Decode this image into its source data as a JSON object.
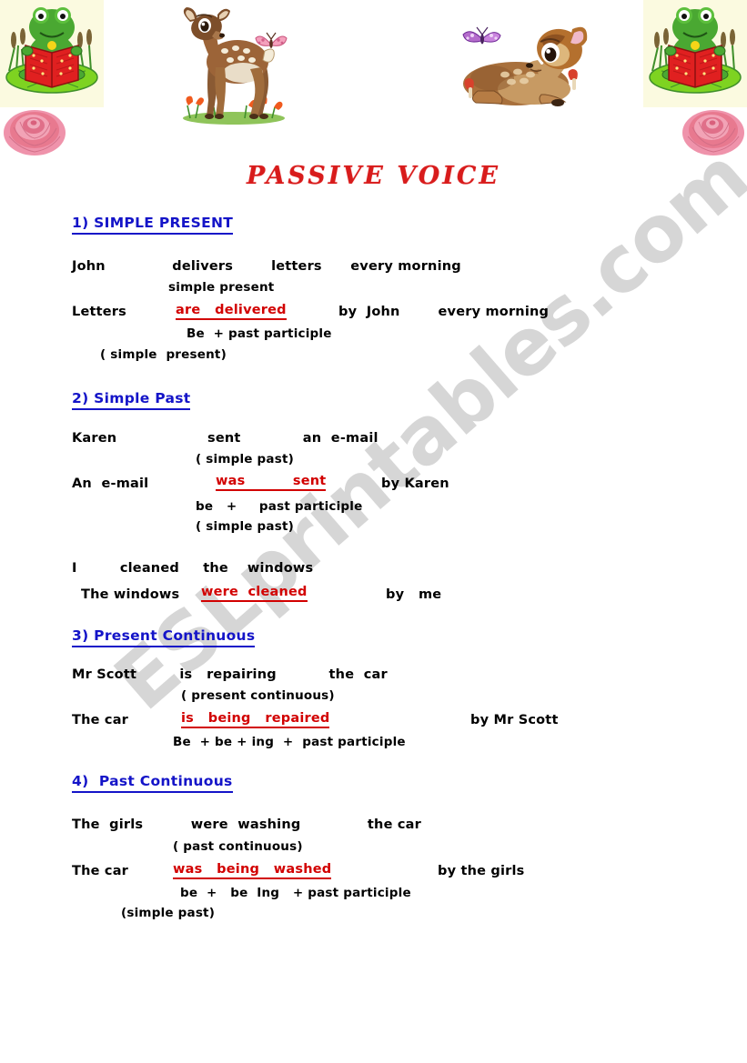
{
  "document": {
    "title": "PASSIVE VOICE",
    "watermark": "ESLprintables.com"
  },
  "clipart": [
    {
      "name": "frog-reading-book-left",
      "alt": "Green frog reading a red book on a lily pad"
    },
    {
      "name": "pink-rose-left",
      "alt": "Pink rose flower"
    },
    {
      "name": "standing-deer-with-butterfly",
      "alt": "Bambi deer standing with a pink butterfly"
    },
    {
      "name": "lying-deer-with-butterfly",
      "alt": "Bambi deer lying down with a purple butterfly"
    },
    {
      "name": "frog-reading-book-right",
      "alt": "Green frog reading a red book on a lily pad"
    },
    {
      "name": "pink-rose-right",
      "alt": "Pink rose flower"
    }
  ],
  "sections": [
    {
      "heading": "1) SIMPLE PRESENT",
      "lines": [
        {
          "id": "s1l1",
          "text": "John              delivers        letters      every morning"
        },
        {
          "id": "s1l2",
          "text": "simple present"
        },
        {
          "id": "s1l3a",
          "text": "Letters"
        },
        {
          "id": "s1l3b",
          "text": "are   delivered"
        },
        {
          "id": "s1l3c",
          "text": "by  John        every morning"
        },
        {
          "id": "s1l4",
          "text": "Be  + past participle"
        },
        {
          "id": "s1l5",
          "text": "( simple  present)"
        }
      ]
    },
    {
      "heading": "2) Simple Past",
      "lines": [
        {
          "id": "s2l1",
          "text": "Karen                   sent             an  e-mail"
        },
        {
          "id": "s2l2",
          "text": "( simple past)"
        },
        {
          "id": "s2l3a",
          "text": "An  e-mail"
        },
        {
          "id": "s2l3b",
          "text": "was          sent"
        },
        {
          "id": "s2l3c",
          "text": "by Karen"
        },
        {
          "id": "s2l4",
          "text": "be   +     past participle"
        },
        {
          "id": "s2l5",
          "text": "( simple past)"
        },
        {
          "id": "s2l6",
          "text": "I         cleaned     the    windows"
        },
        {
          "id": "s2l7a",
          "text": "The windows"
        },
        {
          "id": "s2l7b",
          "text": "were  cleaned"
        },
        {
          "id": "s2l7c",
          "text": "by   me"
        }
      ]
    },
    {
      "heading": "3) Present Continuous",
      "lines": [
        {
          "id": "s3l1",
          "text": "Mr Scott         is   repairing           the  car"
        },
        {
          "id": "s3l2",
          "text": "( present continuous)"
        },
        {
          "id": "s3l3a",
          "text": "The car"
        },
        {
          "id": "s3l3b",
          "text": "is   being   repaired"
        },
        {
          "id": "s3l3c",
          "text": "by Mr Scott"
        },
        {
          "id": "s3l4",
          "text": "Be  + be + ing  +  past participle"
        }
      ]
    },
    {
      "heading": "4)  Past Continuous",
      "lines": [
        {
          "id": "s4l1",
          "text": "The  girls          were  washing              the car"
        },
        {
          "id": "s4l2",
          "text": "( past continuous)"
        },
        {
          "id": "s4l3a",
          "text": "The car"
        },
        {
          "id": "s4l3b",
          "text": "was   being   washed"
        },
        {
          "id": "s4l3c",
          "text": "by the girls"
        },
        {
          "id": "s4l4",
          "text": "be  +   be  Ing   + past participle"
        },
        {
          "id": "s4l5",
          "text": "(simple past)"
        }
      ]
    }
  ],
  "colors": {
    "heading_blue": "#1414c8",
    "passive_red": "#d20000",
    "title_red": "#d81c1c",
    "watermark_grey": "#c9c9c9"
  }
}
